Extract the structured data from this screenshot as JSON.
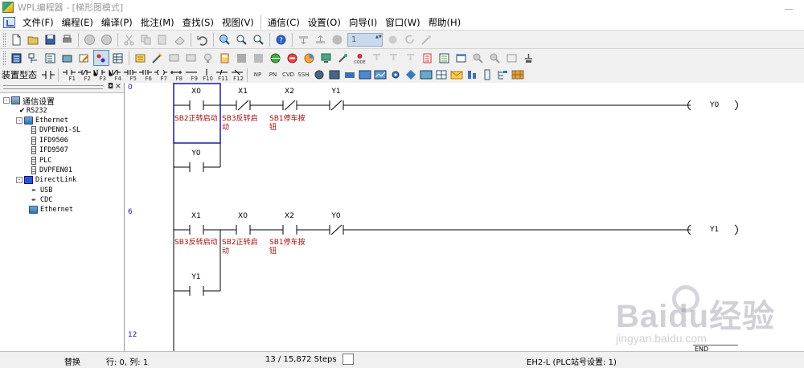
{
  "window": {
    "title": "WPL编程器 - [梯形图模式]"
  },
  "menu": [
    "文件(F)",
    "编程(E)",
    "编译(P)",
    "批注(M)",
    "查找(S)",
    "视图(V)",
    "通信(C)",
    "设置(O)",
    "向导(I)",
    "窗口(W)",
    "帮助(H)"
  ],
  "toolbar": {
    "step_value": "1"
  },
  "devtoolbar": {
    "label": "装置型态",
    "keys": [
      "F1",
      "F2",
      "F3",
      "F4",
      "F5",
      "F6",
      "F7",
      "F8",
      "F9",
      "F10",
      "F11",
      "F12"
    ]
  },
  "tree": {
    "root": "通信设置",
    "rs232": "RS232",
    "ethernet": "Ethernet",
    "ethernet_children": [
      "DVPEN01-SL",
      "IFD9506",
      "IFD9507",
      "PLC",
      "DVPFEN01"
    ],
    "directlink": "DirectLink",
    "directlink_children": [
      "USB",
      "CDC",
      "Ethernet"
    ]
  },
  "ladder": {
    "rung_numbers": [
      "0",
      "6",
      "12"
    ],
    "rung1": {
      "contacts": [
        {
          "name": "X0",
          "comment": "SB2正转启动"
        },
        {
          "name": "X1",
          "comment": "SB3反转启动"
        },
        {
          "name": "X2",
          "comment": "SB1停车按钮"
        },
        {
          "name": "Y1",
          "comment": ""
        }
      ],
      "branch": "Y0",
      "coil": "Y0"
    },
    "rung2": {
      "contacts": [
        {
          "name": "X1",
          "comment": "SB3反转启动"
        },
        {
          "name": "X0",
          "comment": "SB2正转启动"
        },
        {
          "name": "X2",
          "comment": "SB1停车按钮"
        },
        {
          "name": "Y0",
          "comment": ""
        }
      ],
      "branch": "Y1",
      "coil": "Y1"
    },
    "end": "END"
  },
  "watermark": {
    "brand": "Baidu经验",
    "url": "jingyan.baidu.com"
  },
  "status": {
    "mode": "替换",
    "position": "行: 0, 列: 1",
    "steps": "13 / 15,872 Steps",
    "plc": "EH2-L (PLC站号设置: 1)"
  },
  "colors": {
    "cursor": "#1c1c9c",
    "comment": "#a01010",
    "rung_number": "#1a1aa0"
  }
}
